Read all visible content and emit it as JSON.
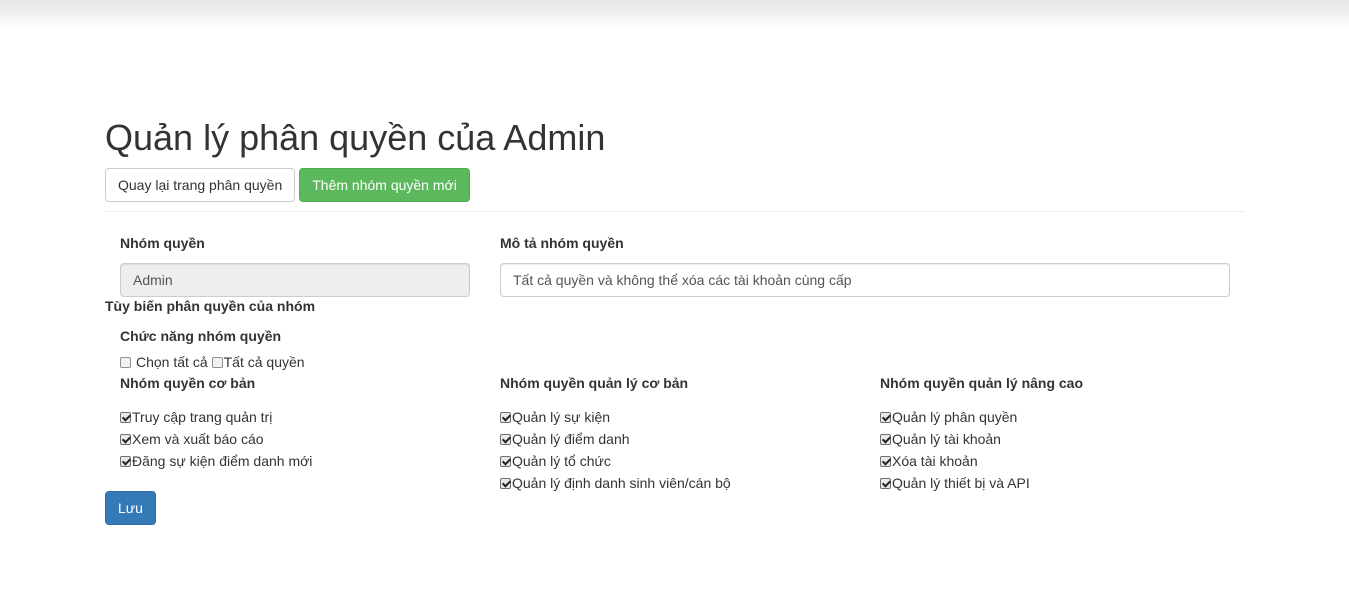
{
  "page": {
    "title": "Quản lý phân quyền của Admin"
  },
  "actions": {
    "back_label": "Quay lại trang phân quyền",
    "add_group_label": "Thêm nhóm quyền mới",
    "save_label": "Lưu"
  },
  "form": {
    "group_label": "Nhóm quyền",
    "group_value": "Admin",
    "description_label": "Mô tả nhóm quyền",
    "description_value": "Tất cả quyền và không thể xóa các tài khoản cùng cấp"
  },
  "customize": {
    "section_title": "Tùy biến phân quyền của nhóm",
    "function_title": "Chức năng nhóm quyền",
    "select_all": {
      "label": "Chọn tất cả",
      "checked": false
    },
    "all_permissions": {
      "label": "Tất cả quyền",
      "checked": false
    },
    "groups": [
      {
        "title": "Nhóm quyền cơ bản",
        "items": [
          {
            "label": "Truy cập trang quản trị",
            "checked": true
          },
          {
            "label": "Xem và xuất báo cáo",
            "checked": true
          },
          {
            "label": "Đăng sự kiện điểm danh mới",
            "checked": true
          }
        ]
      },
      {
        "title": "Nhóm quyền quản lý cơ bản",
        "items": [
          {
            "label": "Quản lý sự kiện",
            "checked": true
          },
          {
            "label": "Quản lý điểm danh",
            "checked": true
          },
          {
            "label": "Quản lý tổ chức",
            "checked": true
          },
          {
            "label": "Quản lý định danh sinh viên/cán bộ",
            "checked": true
          }
        ]
      },
      {
        "title": "Nhóm quyền quản lý nâng cao",
        "items": [
          {
            "label": "Quản lý phân quyền",
            "checked": true
          },
          {
            "label": "Quản lý tài khoản",
            "checked": true
          },
          {
            "label": "Xóa tài khoản",
            "checked": true
          },
          {
            "label": "Quản lý thiết bị và API",
            "checked": true
          }
        ]
      }
    ]
  },
  "colors": {
    "success": "#5cb85c",
    "primary": "#337ab7",
    "disabled_input_bg": "#eeeeee"
  }
}
